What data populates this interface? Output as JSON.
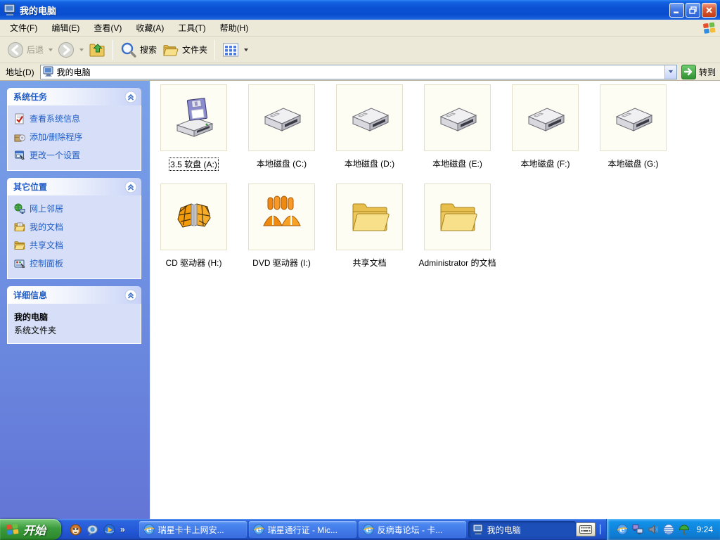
{
  "window": {
    "title": "我的电脑"
  },
  "menu": {
    "items": [
      {
        "label": "文件(F)"
      },
      {
        "label": "编辑(E)"
      },
      {
        "label": "查看(V)"
      },
      {
        "label": "收藏(A)"
      },
      {
        "label": "工具(T)"
      },
      {
        "label": "帮助(H)"
      }
    ]
  },
  "toolbar": {
    "back_label": "后退",
    "search_label": "搜索",
    "folders_label": "文件夹"
  },
  "address": {
    "label": "地址(D)",
    "value": "我的电脑",
    "go_label": "转到"
  },
  "sidebar": {
    "system_tasks": {
      "title": "系统任务",
      "items": [
        {
          "label": "查看系统信息",
          "icon": "system-info-icon"
        },
        {
          "label": "添加/删除程序",
          "icon": "add-remove-programs-icon"
        },
        {
          "label": "更改一个设置",
          "icon": "change-setting-icon"
        }
      ]
    },
    "other_places": {
      "title": "其它位置",
      "items": [
        {
          "label": "网上邻居",
          "icon": "network-places-icon"
        },
        {
          "label": "我的文档",
          "icon": "my-documents-icon"
        },
        {
          "label": "共享文档",
          "icon": "shared-documents-icon"
        },
        {
          "label": "控制面板",
          "icon": "control-panel-icon"
        }
      ]
    },
    "details": {
      "title": "详细信息",
      "name": "我的电脑",
      "type": "系统文件夹"
    }
  },
  "content": {
    "items": [
      {
        "label": "3.5 软盘 (A:)",
        "icon": "floppy-drive",
        "selected": true
      },
      {
        "label": "本地磁盘 (C:)",
        "icon": "hard-disk"
      },
      {
        "label": "本地磁盘 (D:)",
        "icon": "hard-disk"
      },
      {
        "label": "本地磁盘 (E:)",
        "icon": "hard-disk"
      },
      {
        "label": "本地磁盘 (F:)",
        "icon": "hard-disk"
      },
      {
        "label": "本地磁盘 (G:)",
        "icon": "hard-disk"
      },
      {
        "label": "CD 驱动器 (H:)",
        "icon": "cd-drive"
      },
      {
        "label": "DVD 驱动器 (I:)",
        "icon": "dvd-drive"
      },
      {
        "label": "共享文档",
        "icon": "folder"
      },
      {
        "label": "Administrator 的文档",
        "icon": "folder"
      }
    ]
  },
  "taskbar": {
    "start_label": "开始",
    "overflow_chevron": "»",
    "quick_launch": [
      {
        "icon": "kaka-icon"
      },
      {
        "icon": "messenger-icon"
      },
      {
        "icon": "media-player-icon"
      }
    ],
    "tasks": [
      {
        "label": "瑞星卡卡上网安...",
        "icon": "ie-icon"
      },
      {
        "label": "瑞星通行证 - Mic...",
        "icon": "ie-icon"
      },
      {
        "label": "反病毒论坛 - 卡...",
        "icon": "ie-icon"
      },
      {
        "label": "我的电脑",
        "icon": "my-computer-icon",
        "active": true
      }
    ],
    "tray": {
      "time": "9:24",
      "icons": [
        "ie-icon",
        "network-icon",
        "volume-icon",
        "antivirus-shield-icon",
        "umbrella-icon"
      ]
    }
  },
  "colors": {
    "titlebar_blue": "#0B51D4",
    "taskbar_blue": "#2458D8",
    "start_green": "#3B9B3B",
    "sidebar_blue": "#6E87DD",
    "link_blue": "#215DC6",
    "tray_blue": "#1290E8"
  }
}
